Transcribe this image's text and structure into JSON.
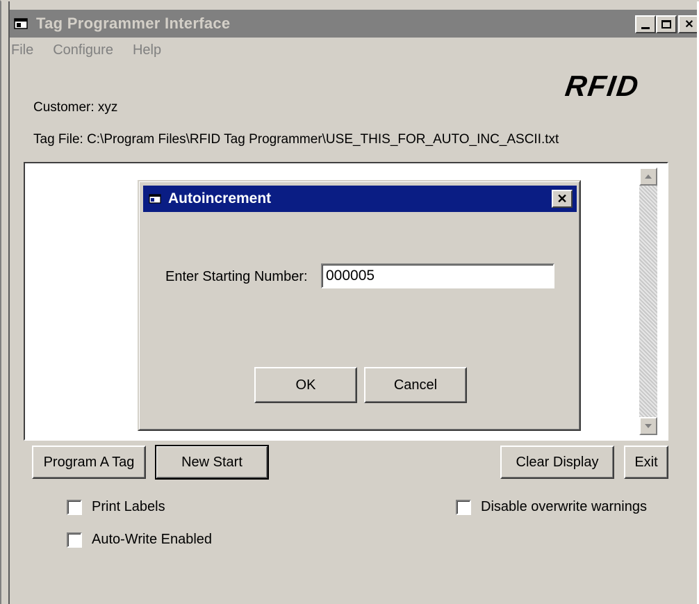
{
  "window": {
    "title": "Tag Programmer Interface",
    "minimize_glyph": "_",
    "maximize_glyph": "□",
    "close_glyph": "✕"
  },
  "menu": {
    "items": [
      {
        "label": "File"
      },
      {
        "label": "Configure"
      },
      {
        "label": "Help"
      }
    ]
  },
  "logo": "RFID",
  "info": {
    "customer": "Customer: xyz",
    "tag_file": "Tag File: C:\\Program Files\\RFID Tag Programmer\\USE_THIS_FOR_AUTO_INC_ASCII.txt"
  },
  "buttons": {
    "program_tag": "Program A Tag",
    "new_start": "New Start",
    "clear_display": "Clear Display",
    "exit": "Exit"
  },
  "checkboxes": {
    "print_labels": {
      "label": "Print Labels",
      "checked": false
    },
    "auto_write": {
      "label": "Auto-Write Enabled",
      "checked": false
    },
    "disable_overwrite": {
      "label": "Disable overwrite warnings",
      "checked": false
    }
  },
  "dialog": {
    "title": "Autoincrement",
    "close_glyph": "✕",
    "field_label": "Enter Starting Number:",
    "field_value": "000005",
    "ok_label": "OK",
    "cancel_label": "Cancel"
  },
  "colors": {
    "dialog_title_bg": "#0a1d84",
    "inactive_title_bg": "#808080",
    "face": "#d4d0c8"
  }
}
